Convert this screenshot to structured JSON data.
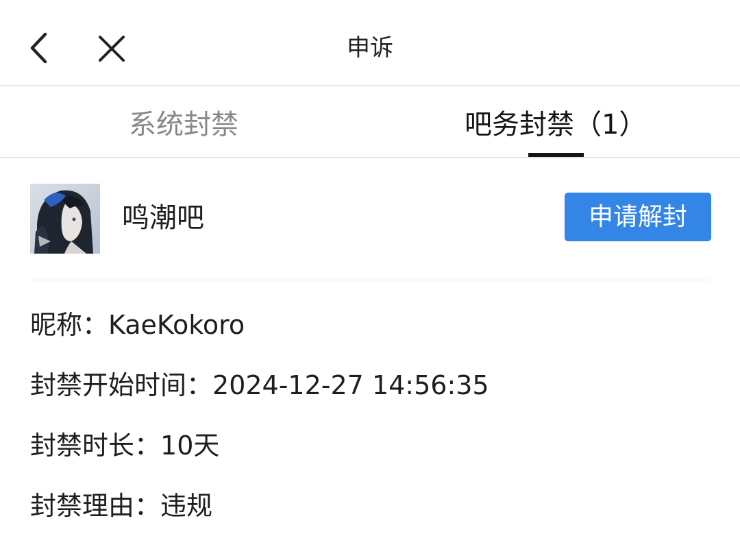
{
  "header": {
    "title": "申诉",
    "back_icon": "chevron-left-icon",
    "close_icon": "close-icon"
  },
  "tabs": [
    {
      "label": "系统封禁",
      "active": false
    },
    {
      "label": "吧务封禁（1）",
      "active": true
    }
  ],
  "ban": {
    "forum_name": "鸣潮吧",
    "appeal_button": "申请解封",
    "accent_color": "#3385e6",
    "nickname_label": "昵称：",
    "nickname_value": "KaeKokoro",
    "start_label": "封禁开始时间：",
    "start_value": "2024-12-27 14:56:35",
    "duration_label": "封禁时长：",
    "duration_value": "10天",
    "reason_label": "封禁理由：",
    "reason_value": "违规"
  }
}
